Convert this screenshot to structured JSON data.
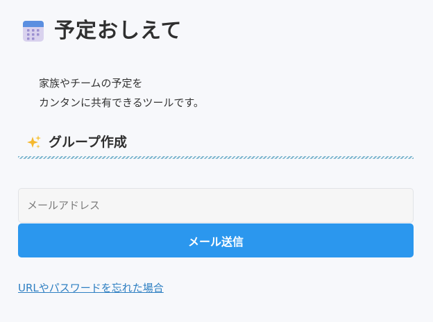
{
  "header": {
    "icon": "calendar-icon",
    "title": "予定おしえて"
  },
  "intro": {
    "line1": "家族やチームの予定を",
    "line2": "カンタンに共有できるツールです。"
  },
  "section": {
    "icon": "sparkles-icon",
    "title": "グループ作成"
  },
  "form": {
    "email_placeholder": "メールアドレス",
    "email_value": "",
    "submit_label": "メール送信"
  },
  "links": {
    "forgot": "URLやパスワードを忘れた場合"
  },
  "colors": {
    "button": "#2b97ee",
    "link": "#2e7fc2",
    "divider": "#7fb7cf",
    "background": "#f7f8fb"
  }
}
